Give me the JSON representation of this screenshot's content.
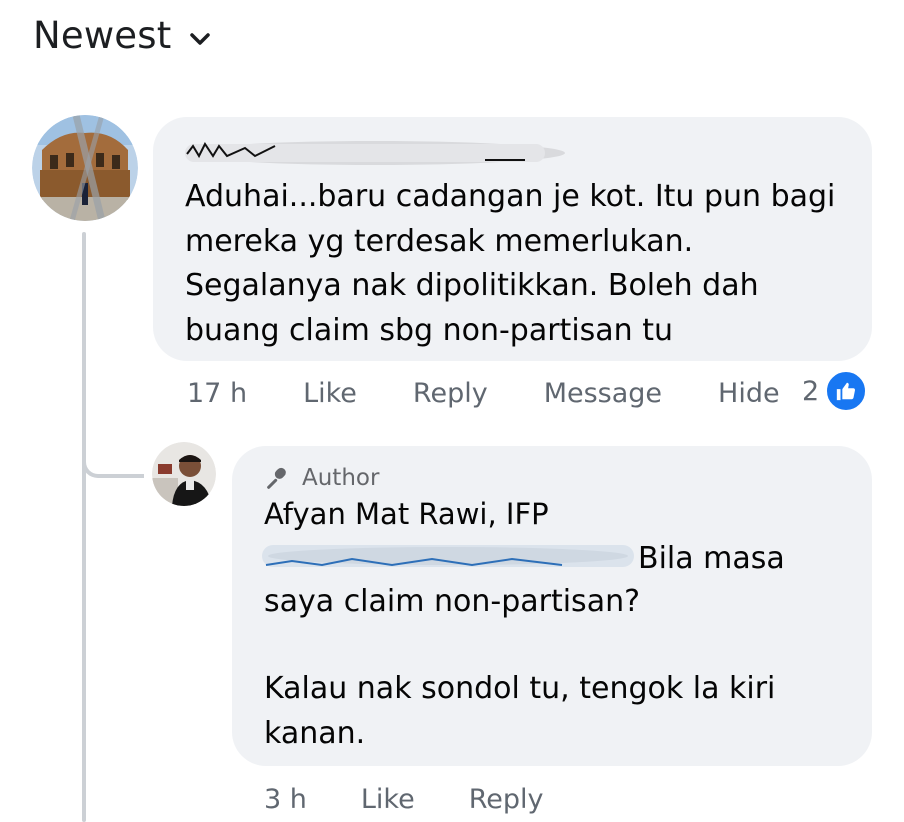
{
  "sort": {
    "label": "Newest",
    "icon": "chevron-down-icon"
  },
  "comment": {
    "text_lines": [
      "Aduhai...baru cadangan je kot. Itu pun bagi",
      "mereka yg terdesak memerlukan.",
      "Segalanya nak dipolitikkan. Boleh dah",
      "buang claim sbg non-partisan tu"
    ],
    "time": "17 h",
    "actions": {
      "like": "Like",
      "reply": "Reply",
      "message": "Message",
      "hide": "Hide"
    },
    "reaction_count": "2",
    "reaction_icon": "like-icon",
    "accent_color": "#1877f2"
  },
  "reply": {
    "badge": "Author",
    "badge_icon": "microphone-icon",
    "name": "Afyan Mat Rawi, IFP",
    "text_first": "Bila masa",
    "text_second": "saya claim non-partisan?",
    "text_third_lines": [
      "Kalau nak sondol tu, tengok la kiri",
      "kanan."
    ],
    "time": "3 h",
    "actions": {
      "like": "Like",
      "reply": "Reply"
    }
  }
}
